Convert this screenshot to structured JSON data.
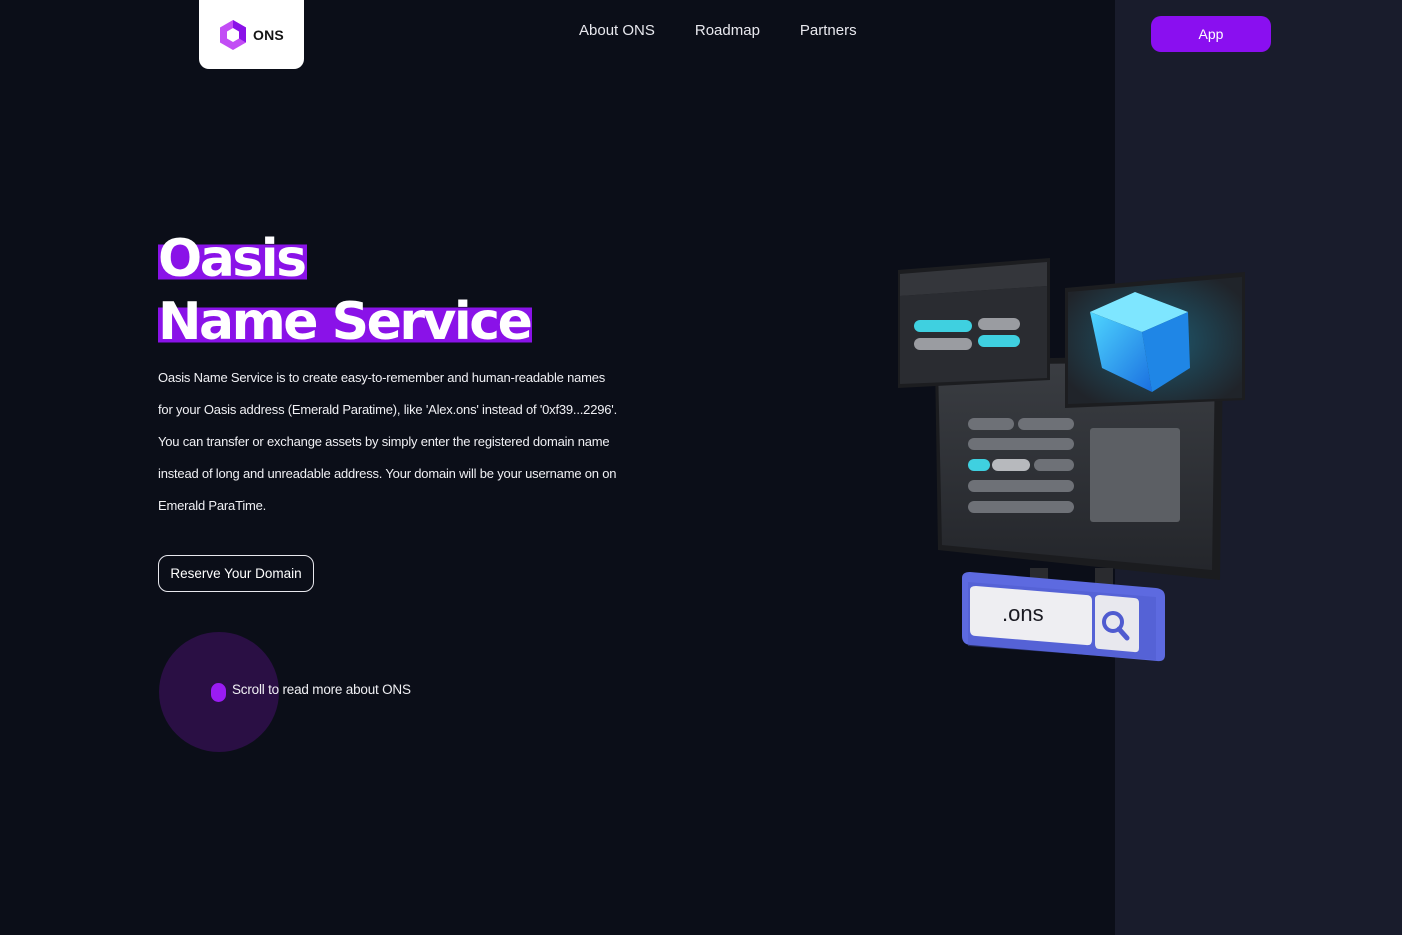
{
  "header": {
    "logo_text": "ONS",
    "nav": [
      {
        "label": "About ONS"
      },
      {
        "label": "Roadmap"
      },
      {
        "label": "Partners"
      }
    ],
    "app_button": "App"
  },
  "hero": {
    "title_line1": "Oasis",
    "title_line2": "Name Service",
    "description": "Oasis Name Service is to create easy-to-remember and human-readable names for your Oasis address (Emerald Paratime), like 'Alex.ons' instead of '0xf39...2296'. You can transfer or exchange assets by simply enter the registered domain name instead of long and unreadable address. Your domain will be your username on on Emerald ParaTime.",
    "reserve_button": "Reserve Your Domain",
    "scroll_hint": "Scroll to read more about ONS"
  },
  "illustration": {
    "search_text": ".ons",
    "icon": "search-icon"
  },
  "colors": {
    "background": "#0b0e18",
    "right_panel": "#191c2c",
    "accent": "#8a0ff0",
    "title_highlight": "#8a12e8",
    "cyan": "#3fd0e0",
    "search_bar": "#5d6ae0"
  }
}
